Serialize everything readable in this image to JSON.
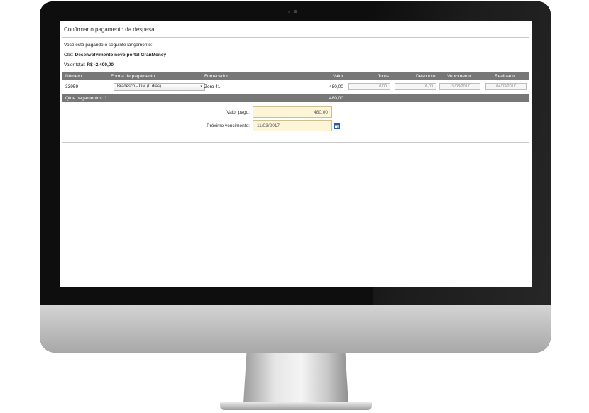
{
  "dialog": {
    "title": "Confirmar o pagamento da despesa",
    "intro": "Você está pagando o seguinte lançamento:",
    "obs_label": "Obs:",
    "obs_value": "Desenvolvimento novo portal GranMoney",
    "total_label": "Valor total:",
    "total_value": "R$ -2.400,00"
  },
  "table": {
    "headers": {
      "numero": "Número",
      "forma": "Forma de pagamento",
      "fornecedor": "Fornecedor",
      "valor": "Valor",
      "juros": "Juros",
      "desconto": "Desconto",
      "vencimento": "Vencimento",
      "realizado": "Realizado"
    },
    "row": {
      "numero": "33959",
      "forma": "Bradesco - GM (0 dias)",
      "fornecedor": "Zero 41",
      "valor": "480,00",
      "juros": "0,00",
      "desconto": "0,00",
      "vencimento": "15/03/2017",
      "realizado": "04/03/2017"
    },
    "footer": {
      "qtde": "Qtde pagamentos: 1",
      "total": "480,00"
    }
  },
  "form": {
    "valor_pago_label": "Valor pago:",
    "valor_pago_value": "480,00",
    "proximo_label": "Próximo vencimento:",
    "proximo_value": "11/03/2017"
  },
  "icons": {
    "select_caret": "▾",
    "calendar": "calendar-icon"
  },
  "colors": {
    "table_header_bg": "#777777",
    "highlight_input_bg": "#fdf5d8",
    "calendar_icon": "#2b5fa8"
  }
}
